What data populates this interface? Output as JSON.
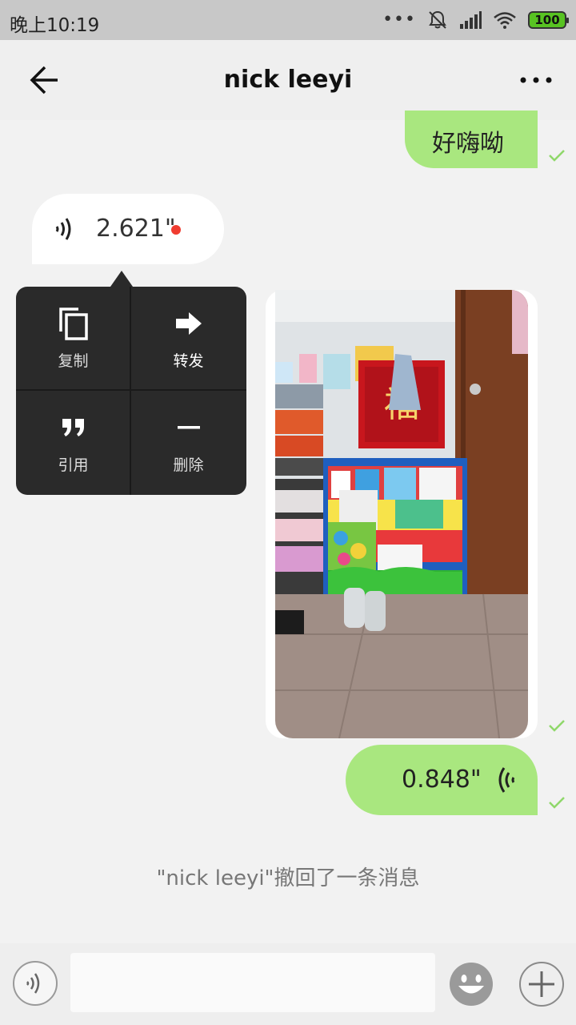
{
  "status_bar": {
    "time": "晚上10:19",
    "battery": "100",
    "icons": [
      "more-dots-icon",
      "mute-icon",
      "signal-icon",
      "wifi-icon",
      "battery-icon"
    ]
  },
  "header": {
    "title": "nick leeyi",
    "back_icon": "arrow-left-icon",
    "menu_icon": "more-horizontal-icon"
  },
  "messages": [
    {
      "type": "text",
      "direction": "outgoing",
      "text": "好嗨呦",
      "status_icon": "check-icon"
    },
    {
      "type": "voice",
      "direction": "incoming",
      "duration": "2.621\"",
      "unread": true
    },
    {
      "type": "image",
      "direction": "outgoing",
      "status_icon": "check-icon"
    },
    {
      "type": "voice",
      "direction": "outgoing",
      "duration": "0.848\"",
      "status_icon": "check-icon"
    }
  ],
  "context_menu": {
    "items": [
      {
        "label": "复制",
        "icon": "copy-icon"
      },
      {
        "label": "转发",
        "icon": "forward-arrow-icon"
      },
      {
        "label": "引用",
        "icon": "quote-icon"
      },
      {
        "label": "删除",
        "icon": "minus-icon"
      }
    ]
  },
  "system_notice": "\"nick leeyi\"撤回了一条消息",
  "input_bar": {
    "placeholder": "",
    "icons": [
      "voice-toggle-icon",
      "emoji-icon",
      "plus-icon"
    ]
  },
  "colors": {
    "outgoing_bubble": "#a9e77f",
    "incoming_bubble": "#ffffff",
    "menu_bg": "#2a2a2a",
    "unread_dot": "#f03c30",
    "tick": "#8fd86a"
  }
}
